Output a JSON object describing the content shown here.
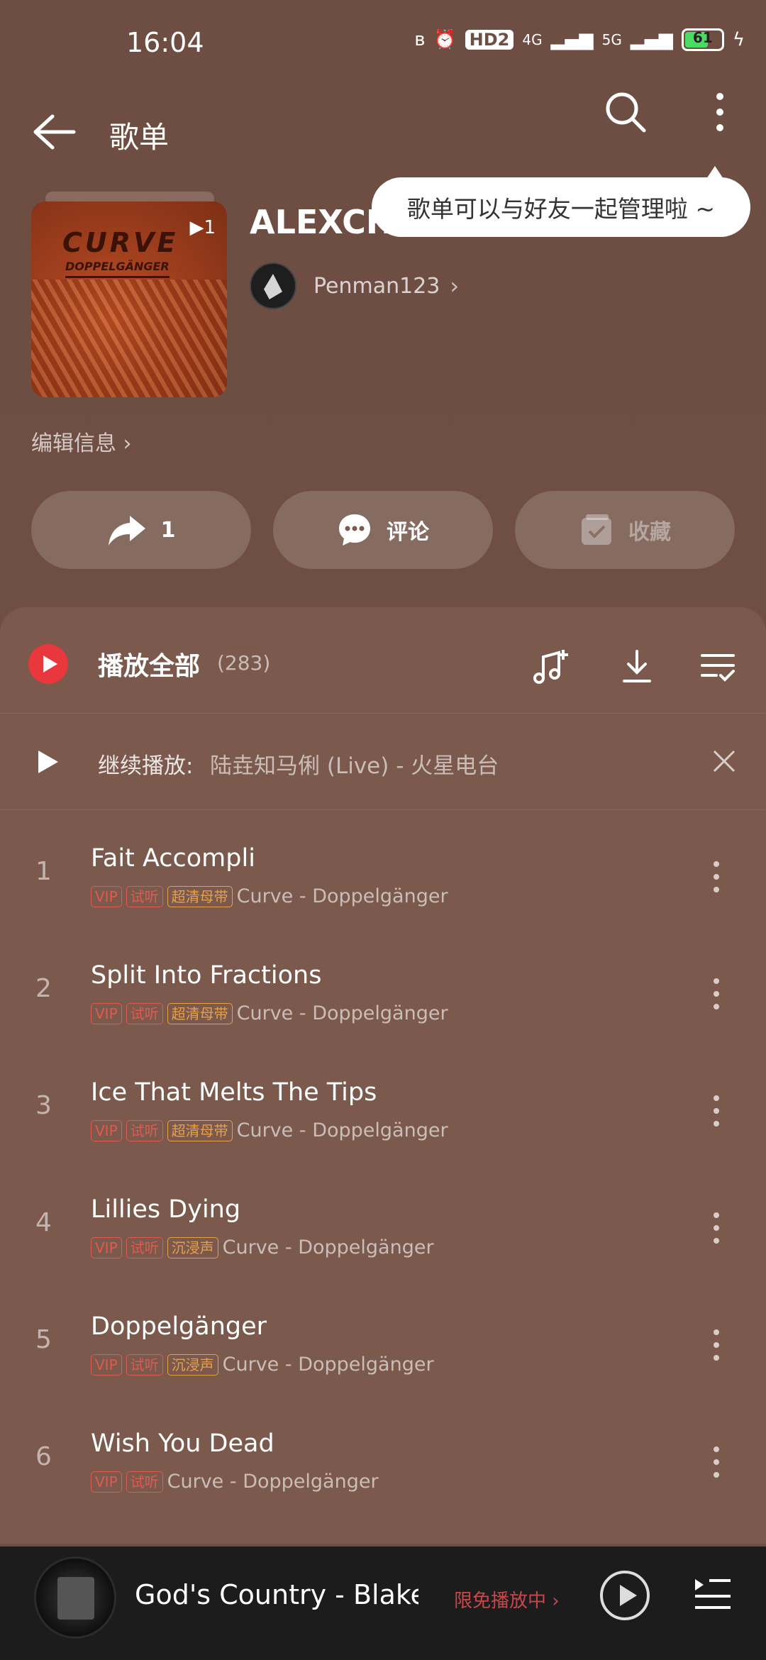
{
  "status_bar": {
    "time": "16:04",
    "hd": "HD2",
    "net1": "4G",
    "net2": "5G",
    "battery": "61"
  },
  "header": {
    "title": "歌单"
  },
  "tooltip": {
    "text": "歌单可以与好友一起管理啦 ~"
  },
  "playlist": {
    "title": "ALEXCHA",
    "cover_play_count": "1",
    "cover_title": "CURVE",
    "cover_subtitle": "DOPPELGÄNGER",
    "creator_name": "Penman123",
    "edit_info": "编辑信息 ›"
  },
  "actions": {
    "share_count": "1",
    "comment": "评论",
    "collect": "收藏"
  },
  "list": {
    "play_all": "播放全部",
    "count": "(283)",
    "resume_label": "继续播放:",
    "resume_track": "陆垚知马俐 (Live) - 火星电台",
    "songs": [
      {
        "num": "1",
        "title": "Fait Accompli",
        "vip": "VIP",
        "trial": "试听",
        "quality": "超清母带",
        "artist": "Curve - Doppelgänger"
      },
      {
        "num": "2",
        "title": "Split Into Fractions",
        "vip": "VIP",
        "trial": "试听",
        "quality": "超清母带",
        "artist": "Curve - Doppelgänger"
      },
      {
        "num": "3",
        "title": "Ice That Melts The Tips",
        "vip": "VIP",
        "trial": "试听",
        "quality": "超清母带",
        "artist": "Curve - Doppelgänger"
      },
      {
        "num": "4",
        "title": "Lillies Dying",
        "vip": "VIP",
        "trial": "试听",
        "quality": "沉浸声",
        "artist": "Curve - Doppelgänger"
      },
      {
        "num": "5",
        "title": "Doppelgänger",
        "vip": "VIP",
        "trial": "试听",
        "quality": "沉浸声",
        "artist": "Curve - Doppelgänger"
      },
      {
        "num": "6",
        "title": "Wish You Dead",
        "vip": "VIP",
        "trial": "试听",
        "quality": "",
        "artist": "Curve - Doppelgänger"
      }
    ]
  },
  "player": {
    "title": "God's Country - Blake",
    "free_label": "限免播放中 ›"
  },
  "colors": {
    "background": "#6f4f43",
    "panel": "#7b594c",
    "accent_red": "#e8383d",
    "tag_gold": "#e6a04a",
    "player_bg": "#1c1c1c"
  }
}
